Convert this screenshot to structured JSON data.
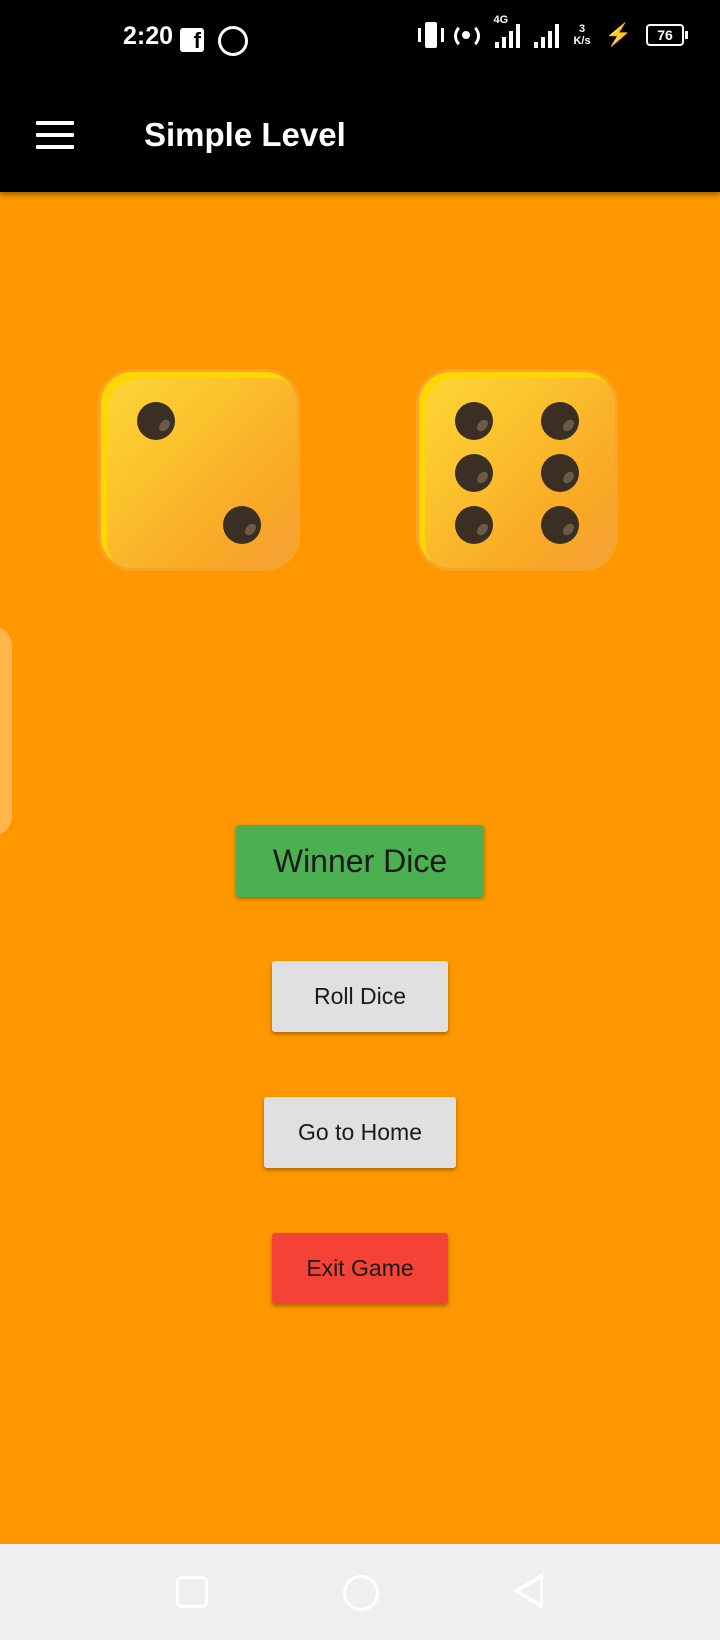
{
  "status_bar": {
    "time": "2:20",
    "network_type": "4G",
    "speed_value": "3",
    "speed_unit": "K/s",
    "battery": "76",
    "icons": [
      "facebook-icon",
      "a-circle-icon",
      "vibrate-icon",
      "hotspot-icon",
      "signal-icon",
      "signal-icon",
      "charging-icon",
      "battery-icon"
    ]
  },
  "app_bar": {
    "title": "Simple Level",
    "menu_icon": "hamburger-menu-icon"
  },
  "dice": [
    {
      "value": 2
    },
    {
      "value": 6
    }
  ],
  "buttons": {
    "winner": "Winner Dice",
    "roll": "Roll Dice",
    "home": "Go to Home",
    "exit": "Exit Game"
  },
  "colors": {
    "background": "#ff9800",
    "winner_button": "#4caf50",
    "neutral_button": "#e0e0e0",
    "exit_button": "#f44336",
    "app_bar": "#000000"
  },
  "nav_bar": {
    "icons": [
      "recents-square-icon",
      "home-circle-icon",
      "back-triangle-icon"
    ]
  }
}
